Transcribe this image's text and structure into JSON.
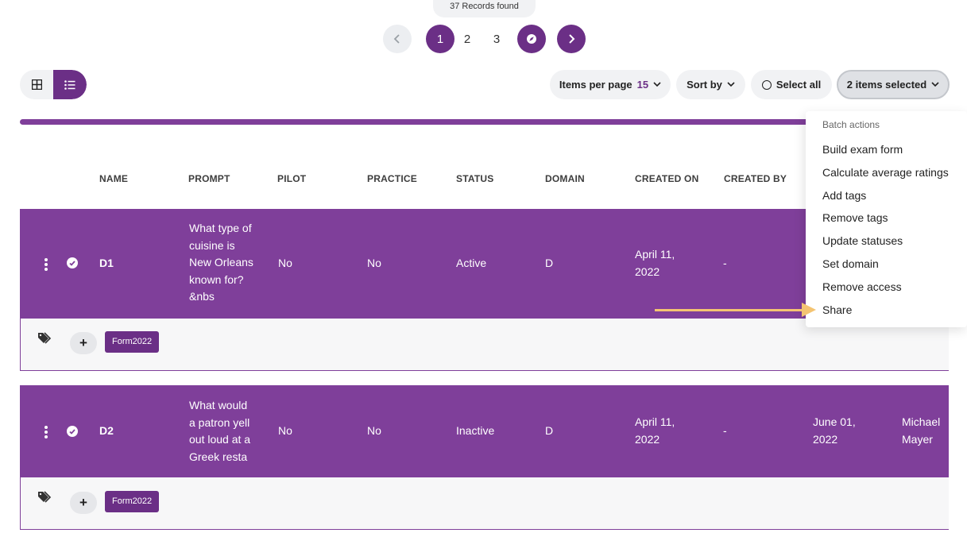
{
  "records": {
    "text": "37 Records found"
  },
  "pagination": {
    "pages": [
      "1",
      "2",
      "3"
    ],
    "active_page": "1"
  },
  "toolbar": {
    "items_per_page_label": "Items per page",
    "items_per_page_value": "15",
    "sort_label": "Sort by",
    "select_all_label": "Select all",
    "selected_label": "2 items selected"
  },
  "progress": {
    "fraction": 0.82
  },
  "table": {
    "headers": {
      "name": "NAME",
      "prompt": "PROMPT",
      "pilot": "PILOT",
      "practice": "PRACTICE",
      "status": "STATUS",
      "domain": "DOMAIN",
      "created_on": "CREATED ON",
      "created_by": "CREATED BY"
    },
    "rows": [
      {
        "name": "D1",
        "prompt": [
          "What type of",
          "cuisine is",
          "New Orleans",
          "known for?",
          "&nbs"
        ],
        "pilot": "No",
        "practice": "No",
        "status": "Active",
        "domain": "D",
        "created_on": [
          "April 11,",
          "2022"
        ],
        "created_by": "-",
        "tag": "Form2022"
      },
      {
        "name": "D2",
        "prompt": [
          "What would",
          "a patron yell",
          "out loud at a",
          "Greek resta"
        ],
        "pilot": "No",
        "practice": "No",
        "status": "Inactive",
        "domain": "D",
        "created_on": [
          "April 11,",
          "2022"
        ],
        "created_by": "-",
        "modified_on": [
          "June 01,",
          "2022"
        ],
        "modified_by": [
          "Michael",
          "Mayer"
        ],
        "tag": "Form2022"
      }
    ]
  },
  "batch_menu": {
    "title": "Batch actions",
    "items": [
      "Build exam form",
      "Calculate average ratings",
      "Add tags",
      "Remove tags",
      "Update statuses",
      "Set domain",
      "Remove access",
      "Share"
    ]
  },
  "colors": {
    "brand": "#6b2f86",
    "row_background": "#7f3f9a",
    "annotation_arrow": "#f4c472"
  }
}
